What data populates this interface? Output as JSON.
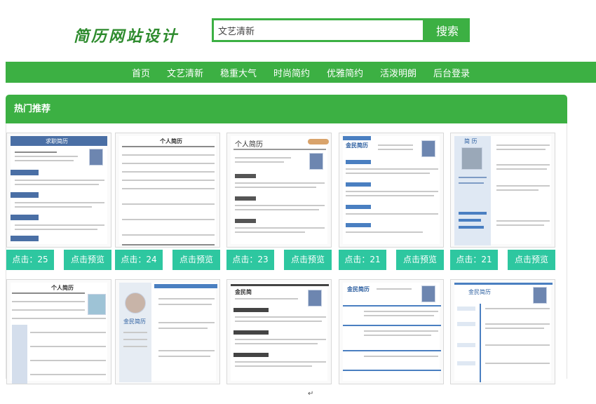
{
  "header": {
    "logo_text": "简历网站设计",
    "search": {
      "value": "文艺清新",
      "button_label": "搜索"
    }
  },
  "nav": {
    "items": [
      "首页",
      "文艺清新",
      "稳重大气",
      "时尚简约",
      "优雅简约",
      "活泼明朗",
      "后台登录"
    ]
  },
  "section": {
    "title": "热门推荐",
    "cards": [
      {
        "thumb_title": "求职简历",
        "clicks": "点击：25",
        "preview_label": "点击预览"
      },
      {
        "thumb_title": "个人简历",
        "clicks": "点击：24",
        "preview_label": "点击预览"
      },
      {
        "thumb_title": "个人简历",
        "clicks": "点击：23",
        "preview_label": "点击预览"
      },
      {
        "thumb_title": "金民简历",
        "clicks": "点击：21",
        "preview_label": "点击预览"
      },
      {
        "thumb_title": "简 历",
        "clicks": "点击：21",
        "preview_label": "点击预览"
      },
      {
        "thumb_title": "个人简历"
      },
      {
        "thumb_title": "金民简历"
      },
      {
        "thumb_title": "金民简"
      },
      {
        "thumb_title": "金民简历"
      },
      {
        "thumb_title": "金民简历"
      }
    ]
  },
  "footer_mark": "↵",
  "colors": {
    "primary": "#3cb043",
    "badge": "#2ec7a0"
  }
}
